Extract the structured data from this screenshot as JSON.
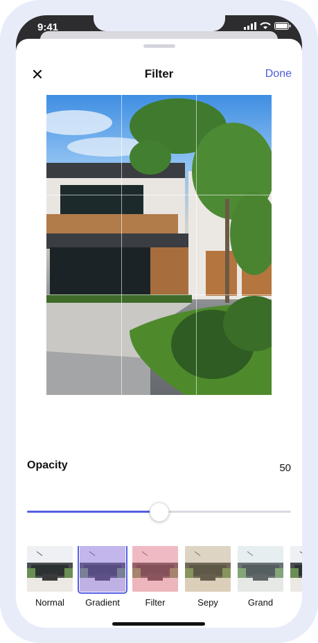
{
  "status": {
    "time": "9:41"
  },
  "header": {
    "title": "Filter",
    "done_label": "Done",
    "close_icon": "close-icon"
  },
  "opacity": {
    "label": "Opacity",
    "value": "50",
    "percent": 50
  },
  "presets": [
    {
      "label": "Normal",
      "tint": "transparent"
    },
    {
      "label": "Gradient",
      "tint": "rgba(140,110,230,0.45)",
      "selected": true
    },
    {
      "label": "Filter",
      "tint": "rgba(240,120,140,0.45)"
    },
    {
      "label": "Sepy",
      "tint": "rgba(190,160,110,0.35)"
    },
    {
      "label": "Grand",
      "tint": "rgba(210,230,230,0.25)"
    },
    {
      "label": "",
      "tint": "transparent"
    }
  ],
  "colors": {
    "accent": "#5560e3",
    "done": "#4d5bd9"
  }
}
